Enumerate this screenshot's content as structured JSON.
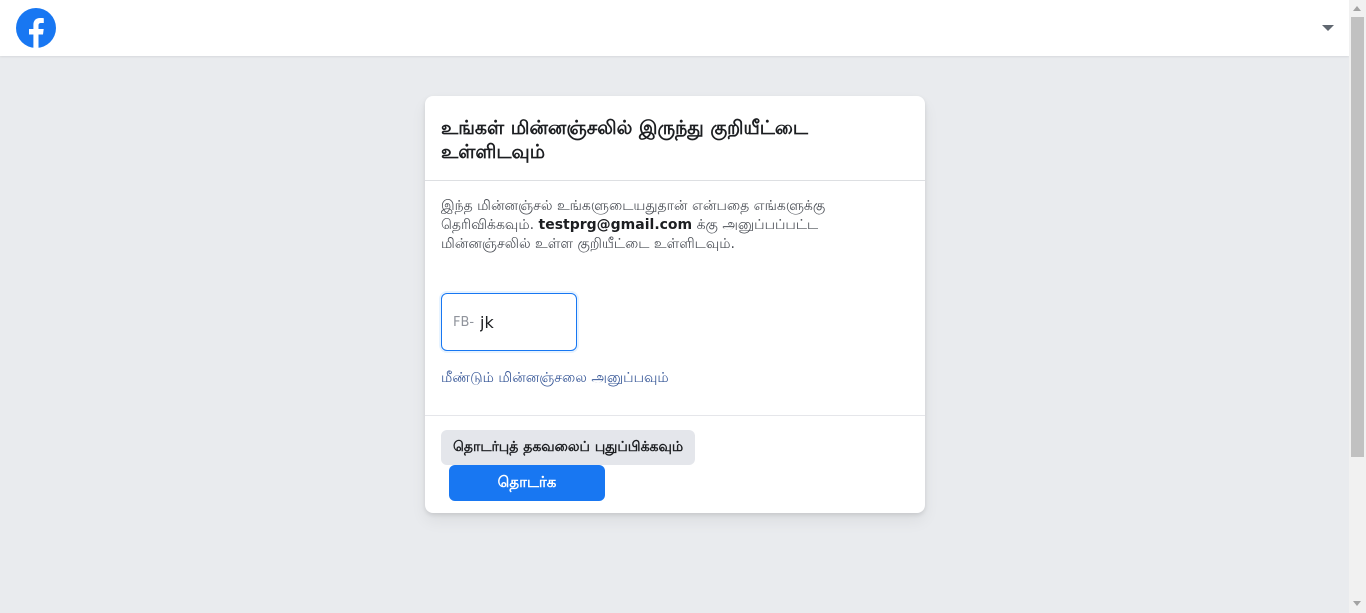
{
  "header": {
    "logo_icon": "facebook-logo-icon",
    "menu_icon": "caret-down-icon"
  },
  "card": {
    "title": "உங்கள் மின்னஞ்சலில் இருந்து குறியீட்டை உள்ளிடவும்",
    "description_part1": "இந்த மின்னஞ்சல் உங்களுடையதுதான் என்பதை எங்களுக்கு தெரிவிக்கவும். ",
    "email": "testprg@gmail.com",
    "description_part2": " க்கு அனுப்பப்பட்ட மின்னஞ்சலில் உள்ள குறியீட்டை உள்ளிடவும்.",
    "code_prefix": "FB-",
    "code_value": "jk",
    "resend_link": "மீண்டும் மின்னஞ்சலை அனுப்பவும்",
    "update_contact_button": "தொடர்புத் தகவலைப் புதுப்பிக்கவும்",
    "continue_button": "தொடர்க"
  },
  "colors": {
    "brand": "#1877f2",
    "page_background": "#e9ebee",
    "link": "#385898"
  }
}
